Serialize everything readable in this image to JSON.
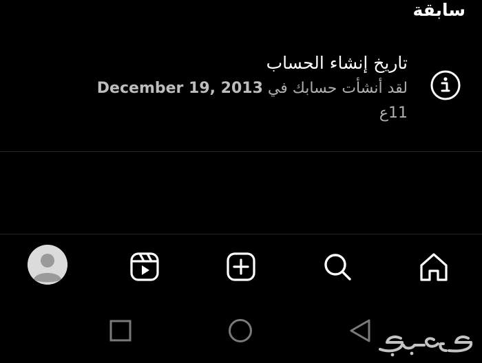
{
  "section_header": "سابقة",
  "account_info": {
    "title": "تاريخ إنشاء الحساب",
    "description_prefix": "لقد أنشأت حسابك في",
    "created_date": "December 19, 2013",
    "relative_age": "11ع",
    "icon": "info-icon"
  },
  "bottom_nav": {
    "items": [
      {
        "name": "profile",
        "icon": "avatar"
      },
      {
        "name": "reels",
        "icon": "reels-icon"
      },
      {
        "name": "create",
        "icon": "plus-square-icon"
      },
      {
        "name": "search",
        "icon": "search-icon"
      },
      {
        "name": "home",
        "icon": "home-icon"
      }
    ]
  },
  "system_nav": {
    "items": [
      {
        "name": "recents",
        "icon": "square-icon"
      },
      {
        "name": "home",
        "icon": "circle-icon"
      },
      {
        "name": "back",
        "icon": "triangle-back-icon"
      }
    ]
  },
  "watermark": "حراج",
  "colors": {
    "background": "#000000",
    "primary_text": "#ffffff",
    "secondary_text": "#b0b0b0",
    "divider": "#2a2a2a",
    "system_icons": "#7a7a7a"
  }
}
